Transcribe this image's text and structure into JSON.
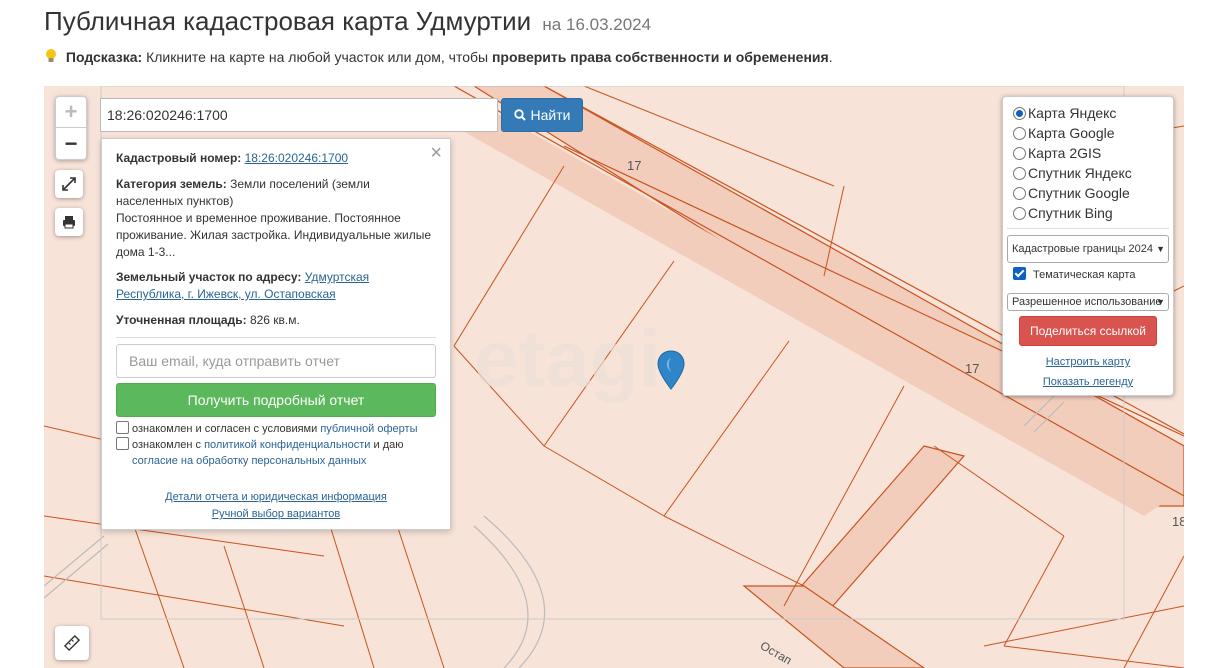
{
  "header": {
    "title": "Публичная кадастровая карта Удмуртии",
    "date": "на 16.03.2024"
  },
  "hint": {
    "label": "Подсказка:",
    "text": " Кликните на карте на любой участок или дом, чтобы ",
    "bold": "проверить права собственности и обременения",
    "end": "."
  },
  "search": {
    "value": "18:26:020246:1700",
    "button_label": "Найти"
  },
  "popup": {
    "close": "×",
    "cadastral_label": "Кадастровый номер:",
    "cadastral_value": "18:26:020246:1700",
    "category_label": "Категория земель:",
    "category_value": "Земли поселений (земли населенных пунктов)",
    "usage_text": "Постоянное и временное проживание. Постоянное проживание. Жилая застройка. Индивидуальные жилые дома 1-3...",
    "address_label": "Земельный участок по адресу:",
    "address_value": "Удмуртская Республика, г. Ижевск, ул. Остаповская",
    "area_label": "Уточненная площадь:",
    "area_value": "826 кв.м.",
    "email_placeholder": "Ваш email, куда отправить отчет",
    "report_button": "Получить подробный отчет",
    "consent1_text": "ознакомлен и согласен с условиями ",
    "consent1_link": "публичной оферты",
    "consent2_text": "ознакомлен с ",
    "consent2_link": "политикой конфиденциальности",
    "consent2_mid": " и даю",
    "consent2_link2": "согласие на обработку персональных данных",
    "details_link": "Детали отчета и юридическая информация",
    "manual_link": "Ручной выбор вариантов"
  },
  "layers": {
    "options": [
      "Карта Яндекс",
      "Карта Google",
      "Карта 2GIS",
      "Спутник Яндекс",
      "Спутник Google",
      "Спутник Bing"
    ],
    "selected": "Карта Яндекс",
    "boundary_select": "Кадастровые границы 2024",
    "thematic_label": "Тематическая карта",
    "thematic_checked": true,
    "usage_select": "Разрешенное использование",
    "share_button": "Поделиться ссылкой",
    "configure_link": "Настроить карту",
    "legend_link": "Показать легенду"
  },
  "map": {
    "labels": [
      "17",
      "17",
      "18"
    ],
    "street": "Остап",
    "watermark": "etagi",
    "zoom_in": "+",
    "zoom_out": "−"
  },
  "colors": {
    "parcel_fill": "#f7e3d8",
    "parcel_border": "#c8541f",
    "road_fill": "#f3cdbc",
    "primary": "#337ab7",
    "success": "#5cb85c",
    "danger": "#d9534f"
  }
}
